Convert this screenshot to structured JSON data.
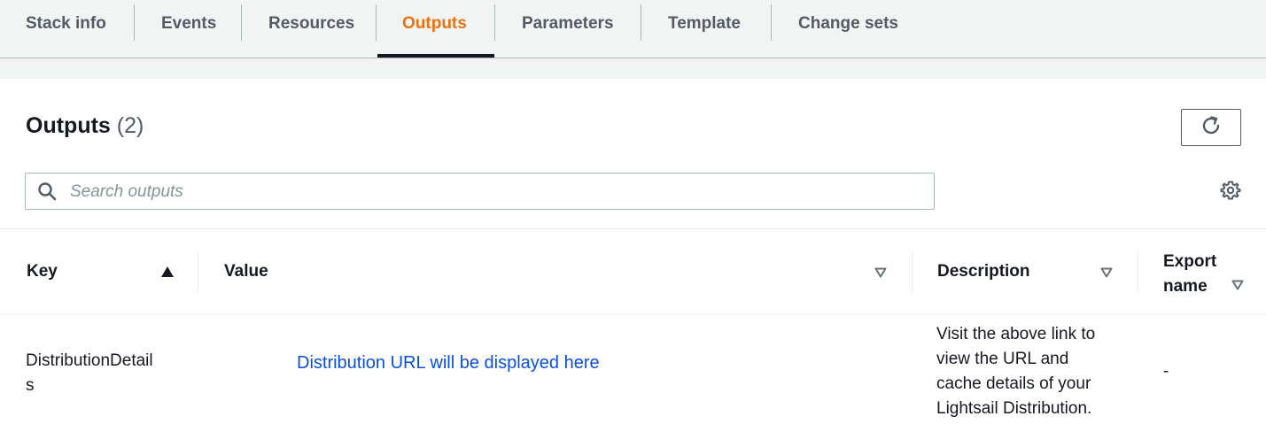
{
  "tabs": [
    {
      "label": "Stack info"
    },
    {
      "label": "Events"
    },
    {
      "label": "Resources"
    },
    {
      "label": "Outputs"
    },
    {
      "label": "Parameters"
    },
    {
      "label": "Template"
    },
    {
      "label": "Change sets"
    }
  ],
  "active_tab": "Outputs",
  "header": {
    "title": "Outputs",
    "count": "(2)"
  },
  "search": {
    "placeholder": "Search outputs",
    "value": ""
  },
  "table": {
    "columns": [
      {
        "label": "Key",
        "sort": "ascending"
      },
      {
        "label": "Value",
        "sort": "none"
      },
      {
        "label": "Description",
        "sort": "none"
      },
      {
        "label_line1": "Export",
        "label_line2": "name",
        "sort": "none"
      }
    ],
    "rows": [
      {
        "key_line1": "DistributionDetail",
        "key_line2": "s",
        "value": "Distribution URL will be displayed here",
        "description_lines": [
          "Visit the above link to",
          "view the URL and",
          "cache details of your",
          "Lightsail Distribution."
        ],
        "export_name": "-"
      }
    ]
  },
  "colors": {
    "accent": "#ec7211",
    "link": "#0a4fe0",
    "text": "#16191f",
    "muted": "#545b64"
  },
  "icons": {
    "refresh": "refresh-icon",
    "search": "search-icon",
    "settings": "gear-icon",
    "sort": "sort-triangle-icon"
  }
}
